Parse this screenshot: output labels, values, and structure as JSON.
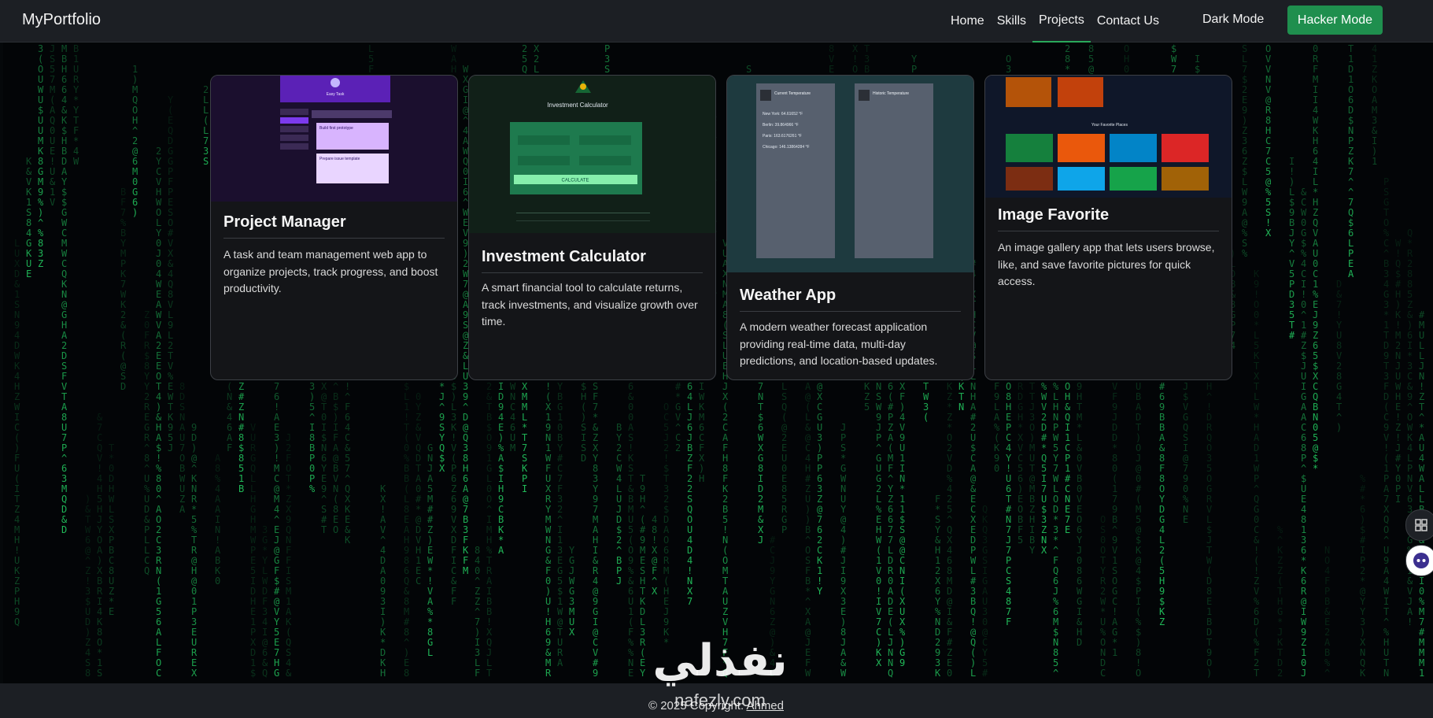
{
  "navbar": {
    "brand": "MyPortfolio",
    "links": [
      {
        "label": "Home"
      },
      {
        "label": "Skills"
      },
      {
        "label": "Projects",
        "active": true
      },
      {
        "label": "Contact Us"
      }
    ],
    "dark_mode": "Dark Mode",
    "hacker_mode": "Hacker Mode"
  },
  "colors": {
    "accent": "#1f8f4e",
    "matrix_green": "#22c55e",
    "nav_bg": "#1c1f24",
    "card_bg": "#141518"
  },
  "projects": [
    {
      "title": "Project Manager",
      "description": "A task and team management web app to organize projects, track progress, and boost productivity.",
      "thumb": {
        "app_title": "Easy Task",
        "cards": [
          "Build first prototype",
          "Prepare issue template"
        ]
      }
    },
    {
      "title": "Investment Calculator",
      "description": "A smart financial tool to calculate returns, track investments, and visualize growth over time.",
      "thumb": {
        "app_title": "Investment Calculator",
        "button": "CALCULATE"
      }
    },
    {
      "title": "Weather App",
      "description": "A modern weather forecast application providing real-time data, multi-day predictions, and location-based updates.",
      "thumb": {
        "panel_a_title": "Current Temperature",
        "panel_b_title": "Historic Temperature",
        "rows": [
          "New York: 64.61652 °F",
          "Berlin: 39.864966 °F",
          "Paris: 163.6176261 °F",
          "Chicago: 146.13864284 °F"
        ]
      }
    },
    {
      "title": "Image Favorite",
      "description": "An image gallery app that lets users browse, like, and save favorite pictures for quick access.",
      "thumb": {
        "section_title": "Your Favorite Places"
      }
    }
  ],
  "footer": {
    "prefix": "© 2025 Copyright: ",
    "author": "Ahmed"
  },
  "watermark": {
    "arabic": "نفذلي",
    "latin": "nafezly.com"
  },
  "side_buttons": [
    "grid-icon",
    "chat-bot-icon"
  ]
}
